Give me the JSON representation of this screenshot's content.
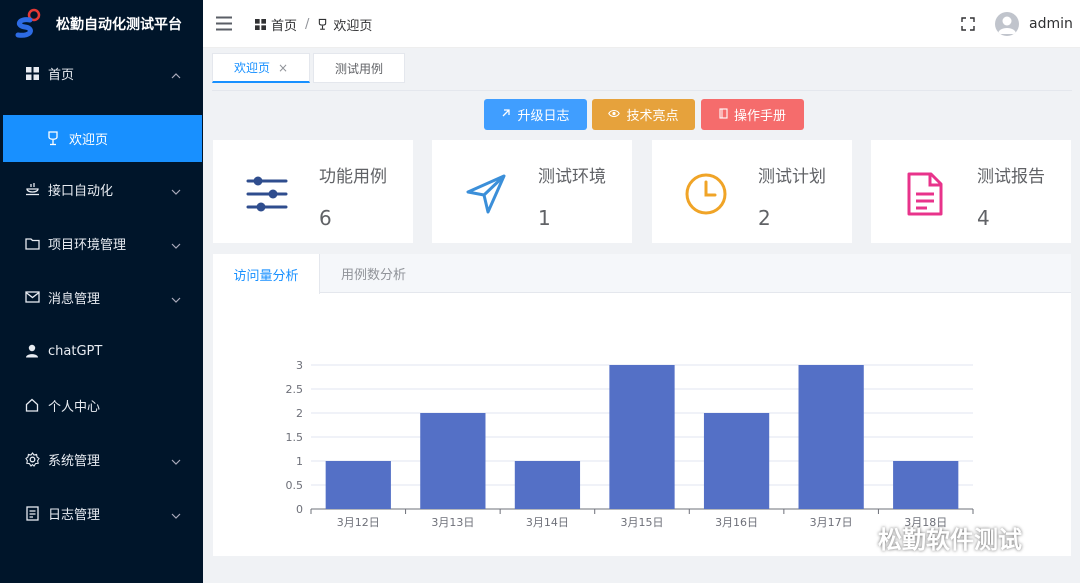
{
  "app": {
    "title": "松勤自动化测试平台"
  },
  "sidebar": {
    "items": [
      {
        "label": "首页",
        "icon": "grid-icon"
      },
      {
        "label": "欢迎页",
        "icon": "trophy-icon"
      },
      {
        "label": "接口自动化",
        "icon": "interface-icon"
      },
      {
        "label": "项目环境管理",
        "icon": "folder-icon"
      },
      {
        "label": "消息管理",
        "icon": "mail-icon"
      },
      {
        "label": "chatGPT",
        "icon": "user-icon"
      },
      {
        "label": "个人中心",
        "icon": "home-icon"
      },
      {
        "label": "系统管理",
        "icon": "gear-icon"
      },
      {
        "label": "日志管理",
        "icon": "document-icon"
      }
    ]
  },
  "header": {
    "breadcrumb": [
      "首页",
      "欢迎页"
    ],
    "username": "admin"
  },
  "tabs": [
    {
      "label": "欢迎页",
      "close": "×"
    },
    {
      "label": "测试用例"
    }
  ],
  "actions": [
    {
      "label": "升级日志",
      "icon": "arrow-up-right-icon",
      "color": "#409eff"
    },
    {
      "label": "技术亮点",
      "icon": "eye-icon",
      "color": "#e6a23c"
    },
    {
      "label": "操作手册",
      "icon": "book-icon",
      "color": "#f56c6c"
    }
  ],
  "stats": [
    {
      "title": "功能用例",
      "value": "6",
      "icon": "sliders-icon",
      "color": "#2f4d8e"
    },
    {
      "title": "测试环境",
      "value": "1",
      "icon": "send-icon",
      "color": "#3b8fd9"
    },
    {
      "title": "测试计划",
      "value": "2",
      "icon": "clock-icon",
      "color": "#f0a427"
    },
    {
      "title": "测试报告",
      "value": "4",
      "icon": "file-text-icon",
      "color": "#e8338b"
    }
  ],
  "panel_tabs": [
    "访问量分析",
    "用例数分析"
  ],
  "chart_data": {
    "type": "bar",
    "categories": [
      "3月12日",
      "3月13日",
      "3月14日",
      "3月15日",
      "3月16日",
      "3月17日",
      "3月18日"
    ],
    "values": [
      1,
      2,
      1,
      3,
      2,
      3,
      1
    ],
    "ylim": [
      0,
      3
    ],
    "yticks": [
      "0",
      "0.5",
      "1",
      "1.5",
      "2",
      "2.5",
      "3"
    ],
    "bar_color": "#5470c6",
    "grid": true
  },
  "watermark": "松勤软件测试"
}
